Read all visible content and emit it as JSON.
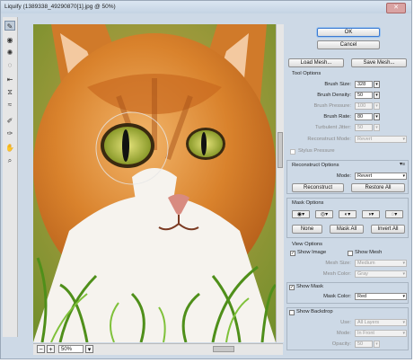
{
  "window": {
    "title": "Liquify (1389338_49290870[1].jpg @ 50%)",
    "close_glyph": "✕"
  },
  "tools": [
    "forward-warp-icon",
    "reconstruct-icon",
    "pucker-icon",
    "bloat-icon",
    "push-left-icon",
    "mirror-icon",
    "turbulence-icon",
    "freeze-mask-icon",
    "thaw-mask-icon",
    "hand-icon",
    "zoom-icon"
  ],
  "buttons": {
    "ok": "OK",
    "cancel": "Cancel",
    "load_mesh": "Load Mesh...",
    "save_mesh": "Save Mesh..."
  },
  "tool_options": {
    "title": "Tool Options",
    "brush_size": {
      "label": "Brush Size:",
      "value": "328"
    },
    "brush_density": {
      "label": "Brush Density:",
      "value": "50"
    },
    "brush_pressure": {
      "label": "Brush Pressure:",
      "value": "100"
    },
    "brush_rate": {
      "label": "Brush Rate:",
      "value": "80"
    },
    "turbulent_jitter": {
      "label": "Turbulent Jitter:",
      "value": "50"
    },
    "reconstruct_mode": {
      "label": "Reconstruct Mode:",
      "value": "Revert"
    },
    "stylus_pressure": "Stylus Pressure"
  },
  "reconstruct_options": {
    "title": "Reconstruct Options",
    "mode_label": "Mode:",
    "mode_value": "Revert",
    "reconstruct": "Reconstruct",
    "restore_all": "Restore All"
  },
  "mask_options": {
    "title": "Mask Options",
    "none": "None",
    "mask_all": "Mask All",
    "invert_all": "Invert All"
  },
  "view_options": {
    "title": "View Options",
    "show_image": "Show Image",
    "show_mesh": "Show Mesh",
    "mesh_size_label": "Mesh Size:",
    "mesh_size_value": "Medium",
    "mesh_color_label": "Mesh Color:",
    "mesh_color_value": "Gray",
    "show_mask": "Show Mask",
    "mask_color_label": "Mask Color:",
    "mask_color_value": "Red",
    "show_backdrop": "Show Backdrop",
    "use_label": "Use:",
    "use_value": "All Layers",
    "mode_label": "Mode:",
    "mode_value": "In Front",
    "opacity_label": "Opacity:",
    "opacity_value": "50"
  },
  "zoom": {
    "value": "50%"
  }
}
